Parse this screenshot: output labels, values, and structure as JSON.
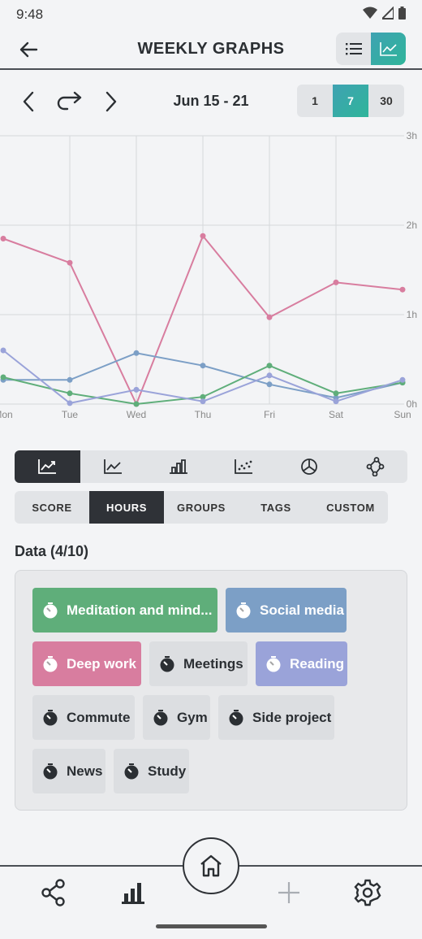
{
  "status": {
    "time": "9:48"
  },
  "header": {
    "title": "WEEKLY GRAPHS"
  },
  "range": {
    "label": "Jun 15 - 21",
    "options": [
      "1",
      "7",
      "30"
    ],
    "selected": "7"
  },
  "chart_data": {
    "type": "line",
    "categories": [
      "Mon",
      "Tue",
      "Wed",
      "Thu",
      "Fri",
      "Sat",
      "Sun"
    ],
    "y_ticks": [
      "0h",
      "1h",
      "2h",
      "3h"
    ],
    "ylim": [
      0,
      3
    ],
    "y_unit": "hours",
    "series": [
      {
        "name": "Deep work",
        "color": "#d87d9f",
        "values": [
          1.85,
          1.58,
          0.0,
          1.88,
          0.97,
          1.36,
          1.28
        ]
      },
      {
        "name": "Social media",
        "color": "#7c9fc6",
        "values": [
          0.27,
          0.27,
          0.57,
          0.43,
          0.22,
          0.07,
          0.24
        ]
      },
      {
        "name": "Meditation and mindfulness",
        "color": "#5fae7a",
        "values": [
          0.3,
          0.12,
          0.0,
          0.08,
          0.43,
          0.12,
          0.24
        ]
      },
      {
        "name": "Reading",
        "color": "#9aa3d9",
        "values": [
          0.6,
          0.01,
          0.16,
          0.03,
          0.32,
          0.03,
          0.27
        ]
      }
    ],
    "grid": true
  },
  "chart_types": [
    "line-chart-icon",
    "trend-chart-icon",
    "bar-chart-icon",
    "scatter-chart-icon",
    "pie-chart-icon",
    "network-chart-icon"
  ],
  "modes": [
    "SCORE",
    "HOURS",
    "GROUPS",
    "TAGS",
    "CUSTOM"
  ],
  "selected_mode": "HOURS",
  "data": {
    "title": "Data (4/10)",
    "chips": [
      {
        "label": "Meditation and mind...",
        "color": "#5fae7a",
        "selected": true
      },
      {
        "label": "Social media",
        "color": "#7c9fc6",
        "selected": true
      },
      {
        "label": "Deep work",
        "color": "#d87d9f",
        "selected": true
      },
      {
        "label": "Meetings",
        "color": "",
        "selected": false
      },
      {
        "label": "Reading",
        "color": "#9aa3d9",
        "selected": true
      },
      {
        "label": "Commute",
        "color": "",
        "selected": false
      },
      {
        "label": "Gym",
        "color": "",
        "selected": false
      },
      {
        "label": "Side project",
        "color": "",
        "selected": false
      },
      {
        "label": "News",
        "color": "",
        "selected": false
      },
      {
        "label": "Study",
        "color": "",
        "selected": false
      }
    ]
  }
}
